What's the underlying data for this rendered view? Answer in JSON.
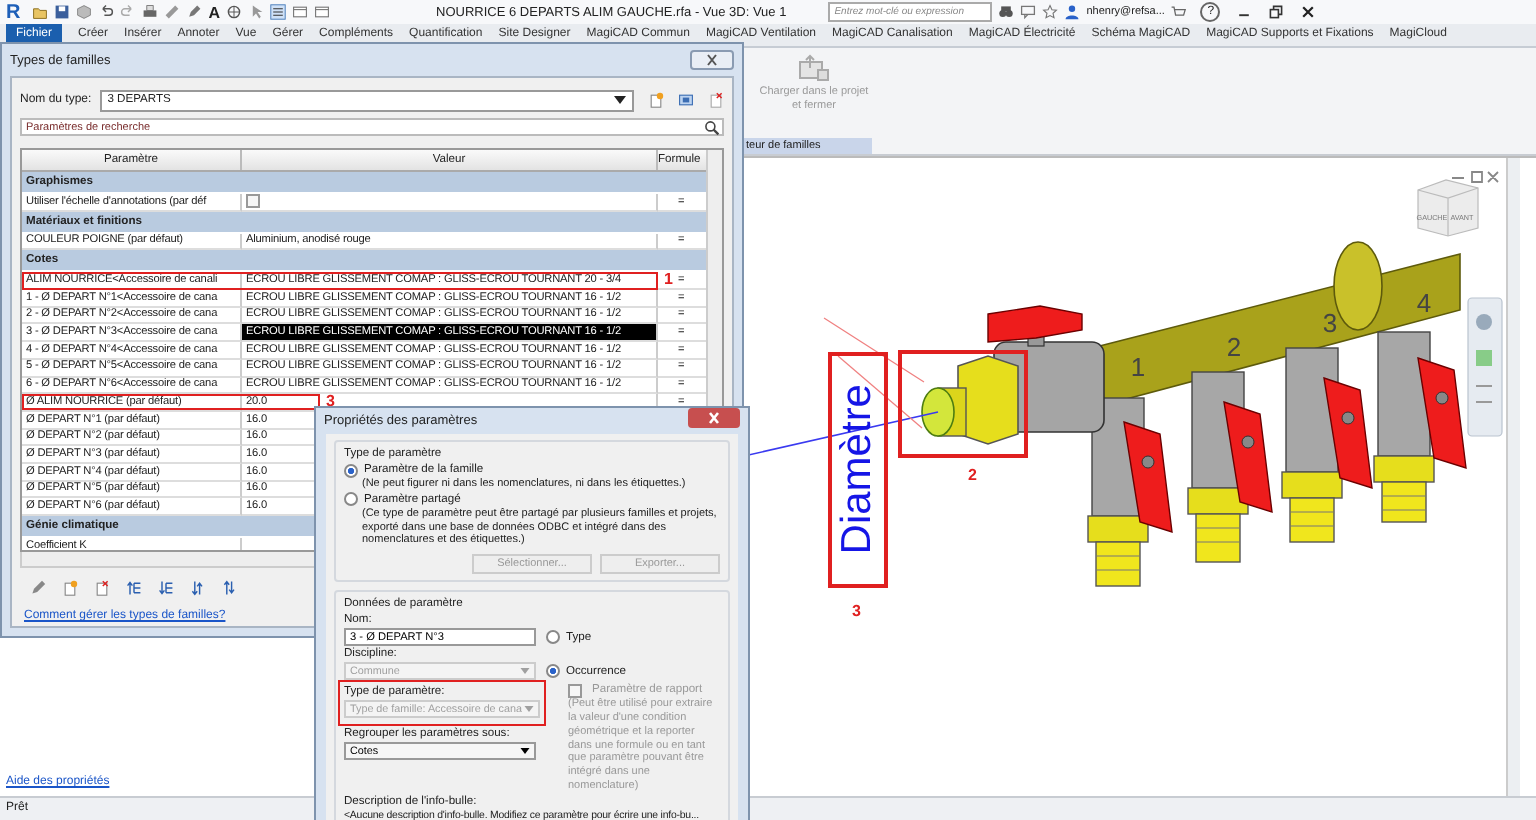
{
  "app_bar": {
    "logo": "R",
    "text_tool": "A",
    "title": "NOURRICE 6 DEPARTS ALIM GAUCHE.rfa - Vue 3D: Vue 1",
    "search": {
      "placeholder": "Entrez mot-clé ou expression"
    },
    "user": "nhenry@refsa...",
    "help": "?"
  },
  "ribbon_tabs": [
    {
      "label": "Fichier",
      "selected": true
    },
    {
      "label": "Créer",
      "selected": false
    },
    {
      "label": "Insérer",
      "selected": false
    },
    {
      "label": "Annoter",
      "selected": false
    },
    {
      "label": "Vue",
      "selected": false
    },
    {
      "label": "Gérer",
      "selected": false
    },
    {
      "label": "Compléments",
      "selected": false
    },
    {
      "label": "Quantification",
      "selected": false
    },
    {
      "label": "Site Designer",
      "selected": false
    },
    {
      "label": "MagiCAD Commun",
      "selected": false
    },
    {
      "label": "MagiCAD Ventilation",
      "selected": false
    },
    {
      "label": "MagiCAD Canalisation",
      "selected": false
    },
    {
      "label": "MagiCAD Électricité",
      "selected": false
    },
    {
      "label": "Schéma MagiCAD",
      "selected": false
    },
    {
      "label": "MagiCAD Supports et Fixations",
      "selected": false
    },
    {
      "label": "MagiCloud",
      "selected": false
    }
  ],
  "ribbon": {
    "button": {
      "label": "Charger dans le projet et fermer",
      "disabled": true
    },
    "panel_label": "teur de familles"
  },
  "properties_palette": {
    "help_link": "Aide des propriétés"
  },
  "view": {
    "diameter_label": "Diamètre",
    "diameter_callout": "3",
    "fitting_callout": "2",
    "outlet_numbers": [
      "1",
      "2",
      "3",
      "4"
    ],
    "viewcube_faces": [
      "GAUCHE",
      "AVANT"
    ]
  },
  "family_types": {
    "title": "Types de familles",
    "type_name_label": "Nom du type:",
    "type_name": "3 DEPARTS",
    "search": {
      "placeholder": "Paramètres de recherche"
    },
    "columns": [
      "Paramètre",
      "Valeur",
      "Formule"
    ],
    "groups": [
      {
        "name": "Graphismes",
        "rows": [
          {
            "kind": "checkbox",
            "parameter": "Utiliser l'échelle d'annotations (par déf",
            "checked": false,
            "formula": "=",
            "selected": false
          }
        ]
      },
      {
        "name": "Matériaux et finitions",
        "rows": [
          {
            "kind": "text",
            "parameter": "COULEUR POIGNE (par défaut)",
            "value": "Aluminium, anodisé rouge",
            "formula": "=",
            "selected": false
          }
        ]
      },
      {
        "name": "Cotes",
        "rows": [
          {
            "kind": "text",
            "parameter": "ALIM NOURRICE<Accessoire de canali",
            "value": "ECROU LIBRE GLISSEMENT COMAP : GLISS-ECROU TOURNANT 20 - 3/4",
            "formula": "=",
            "selected": false,
            "callout": "1"
          },
          {
            "kind": "text",
            "parameter": "1 - Ø DEPART N°1<Accessoire de cana",
            "value": "ECROU LIBRE GLISSEMENT COMAP : GLISS-ECROU TOURNANT 16 - 1/2",
            "formula": "=",
            "selected": false
          },
          {
            "kind": "text",
            "parameter": "2 - Ø DEPART N°2<Accessoire de cana",
            "value": "ECROU LIBRE GLISSEMENT COMAP : GLISS-ECROU TOURNANT 16 - 1/2",
            "formula": "=",
            "selected": false
          },
          {
            "kind": "text",
            "parameter": "3 - Ø DEPART N°3<Accessoire de cana",
            "value": "ECROU LIBRE GLISSEMENT COMAP : GLISS-ECROU TOURNANT 16 - 1/2",
            "formula": "=",
            "selected": true
          },
          {
            "kind": "text",
            "parameter": "4 - Ø DEPART N°4<Accessoire de cana",
            "value": "ECROU LIBRE GLISSEMENT COMAP : GLISS-ECROU TOURNANT 16 - 1/2",
            "formula": "=",
            "selected": false
          },
          {
            "kind": "text",
            "parameter": "5 - Ø DEPART N°5<Accessoire de cana",
            "value": "ECROU LIBRE GLISSEMENT COMAP : GLISS-ECROU TOURNANT 16 - 1/2",
            "formula": "=",
            "selected": false
          },
          {
            "kind": "text",
            "parameter": "6 - Ø DEPART N°6<Accessoire de cana",
            "value": "ECROU LIBRE GLISSEMENT COMAP : GLISS-ECROU TOURNANT 16 - 1/2",
            "formula": "=",
            "selected": false
          },
          {
            "kind": "text",
            "parameter": "Ø ALIM NOURRICE (par défaut)",
            "value": "20.0",
            "formula": "=",
            "selected": false,
            "callout": "3"
          },
          {
            "kind": "text",
            "parameter": "Ø DEPART N°1 (par défaut)",
            "value": "16.0",
            "selected": false
          },
          {
            "kind": "text",
            "parameter": "Ø DEPART N°2 (par défaut)",
            "value": "16.0",
            "selected": false
          },
          {
            "kind": "text",
            "parameter": "Ø DEPART N°3 (par défaut)",
            "value": "16.0",
            "selected": false
          },
          {
            "kind": "text",
            "parameter": "Ø DEPART N°4 (par défaut)",
            "value": "16.0",
            "selected": false
          },
          {
            "kind": "text",
            "parameter": "Ø DEPART N°5 (par défaut)",
            "value": "16.0",
            "selected": false
          },
          {
            "kind": "text",
            "parameter": "Ø DEPART N°6 (par défaut)",
            "value": "16.0",
            "selected": false
          }
        ]
      },
      {
        "name": "Génie climatique",
        "rows": [
          {
            "kind": "text",
            "parameter": "Coefficient K",
            "selected": false
          }
        ]
      }
    ],
    "help_link": "Comment gérer les types de familles?"
  },
  "parameter_properties": {
    "title": "Propriétés des paramètres",
    "type_group": "Type de paramètre",
    "param_kinds": [
      {
        "label": "Paramètre de la famille",
        "selected": true,
        "note": "(Ne peut figurer ni dans les nomenclatures, ni dans les étiquettes.)"
      },
      {
        "label": "Paramètre partagé",
        "selected": false,
        "note": "(Ce type de paramètre peut être partagé par plusieurs familles et projets, exporté dans une base de données ODBC et intégré dans des nomenclatures et des étiquettes.)"
      }
    ],
    "shared_buttons": [
      {
        "label": "Sélectionner...",
        "disabled": true
      },
      {
        "label": "Exporter...",
        "disabled": true
      }
    ],
    "data_group": "Données de paramètre",
    "name_label": "Nom:",
    "name": "3 - Ø DEPART N°3",
    "discipline_label": "Discipline:",
    "discipline": {
      "value": "Commune",
      "disabled": true
    },
    "scope": [
      {
        "label": "Type",
        "selected": false
      },
      {
        "label": "Occurrence",
        "selected": true
      }
    ],
    "report": {
      "label": "Paramètre de rapport",
      "checked": false,
      "disabled": true,
      "note": "(Peut être utilisé pour extraire la valeur d'une condition géométrique et la reporter dans une formule ou en tant que paramètre pouvant être intégré dans une nomenclature)"
    },
    "param_type_label": "Type de paramètre:",
    "param_type": {
      "value": "Type de famille: Accessoire de cana",
      "disabled": true
    },
    "param_type_callout": true,
    "group_label": "Regrouper les paramètres sous:",
    "group": {
      "value": "Cotes",
      "disabled": false
    },
    "tooltip_label": "Description de l'info-bulle:",
    "tooltip": "<Aucune description d'info-bulle. Modifiez ce paramètre pour écrire une info-bu..."
  },
  "status_bar": "Prêt"
}
